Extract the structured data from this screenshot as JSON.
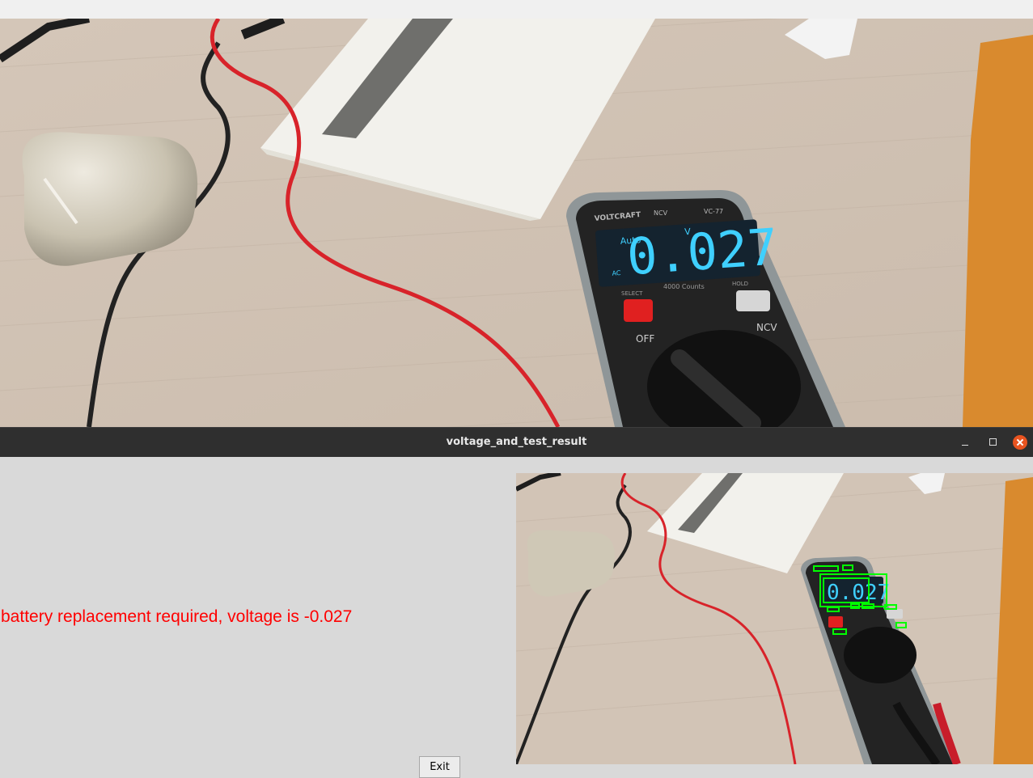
{
  "window": {
    "title": "voltage_and_test_result"
  },
  "result": {
    "message": "battery replacement required, voltage is -0.027"
  },
  "buttons": {
    "exit_label": "Exit"
  },
  "meter": {
    "brand": "VOLTCRAFT",
    "ncv_label": "NCV",
    "model": "VC-77",
    "mode": "Auto",
    "unit": "V",
    "ac_label": "AC",
    "reading": "0.027",
    "counts": "4000 Counts",
    "select_label": "SELECT",
    "hold_label": "HOLD",
    "off_label": "OFF",
    "ncv_dial_label": "NCV"
  },
  "colors": {
    "titlebar": "#2f2f2f",
    "close_button": "#e95420",
    "result_text": "#ff0000",
    "detection_box": "#00ff00",
    "lcd_digits": "#3fd0ff"
  }
}
